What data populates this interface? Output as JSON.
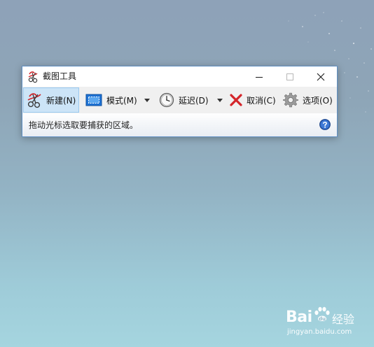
{
  "window": {
    "title": "截图工具"
  },
  "toolbar": {
    "new_label": "新建(N)",
    "mode_label": "模式(M)",
    "delay_label": "延迟(D)",
    "cancel_label": "取消(C)",
    "options_label": "选项(O)"
  },
  "status": {
    "text": "拖动光标选取要捕获的区域。"
  },
  "watermark": {
    "brand": "Bai",
    "brand_suffix": "经验",
    "url": "jingyan.baidu.com"
  },
  "colors": {
    "accent": "#3a89d8",
    "active_button_bg": "#cce4f7",
    "cancel_red": "#d4252a",
    "window_border": "#5f8fc3"
  }
}
